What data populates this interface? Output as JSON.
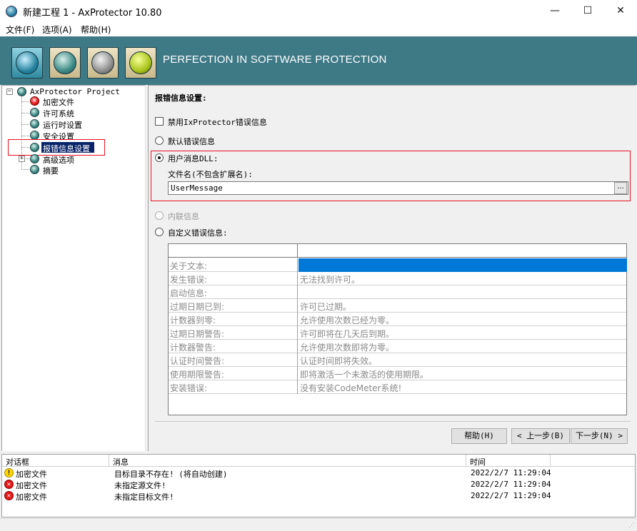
{
  "window": {
    "title": "新建工程 1 - AxProtector 10.80",
    "controls": {
      "minimize": "—",
      "maximize": "☐",
      "close": "✕"
    }
  },
  "menu": [
    "文件(F)",
    "选项(A)",
    "帮助(H)"
  ],
  "banner": {
    "tagline": "PERFECTION IN SOFTWARE PROTECTION",
    "tools": [
      "refresh-icon",
      "document-icon",
      "gears-icon",
      "settings-gear-icon"
    ]
  },
  "tree": {
    "root": "AxProtector Project",
    "items": [
      {
        "label": "加密文件",
        "icon": "error-icon",
        "expander": ""
      },
      {
        "label": "许可系统",
        "icon": "globe-icon",
        "expander": ""
      },
      {
        "label": "运行时设置",
        "icon": "globe-icon",
        "expander": ""
      },
      {
        "label": "安全设置",
        "icon": "globe-icon",
        "expander": ""
      },
      {
        "label": "报错信息设置",
        "icon": "globe-icon",
        "expander": "",
        "selected": true
      },
      {
        "label": "高级选项",
        "icon": "globe-icon",
        "expander": "+"
      },
      {
        "label": "摘要",
        "icon": "globe-icon",
        "expander": ""
      }
    ]
  },
  "panel": {
    "heading": "报错信息设置:",
    "disable_checkbox": "禁用IxProtector错误信息",
    "opt_default": "默认错误信息",
    "opt_user_dll": "用户消息DLL:",
    "filename_label": "文件名(不包含扩展名):",
    "filename_value": "UserMessage",
    "browse": "...",
    "opt_inline": "内联信息",
    "opt_custom": "自定义错误信息:",
    "grid": [
      {
        "key": "关于文本:",
        "value": ""
      },
      {
        "key": "发生错误:",
        "value": "无法找到许可。"
      },
      {
        "key": "启动信息:",
        "value": ""
      },
      {
        "key": "过期日期已到:",
        "value": "许可已过期。"
      },
      {
        "key": "计数器到零:",
        "value": "允许使用次数已经为零。"
      },
      {
        "key": "过期日期警告:",
        "value": "许可即将在几天后到期。"
      },
      {
        "key": "计数器警告:",
        "value": "允许使用次数即将为零。"
      },
      {
        "key": "认证时间警告:",
        "value": "认证时间即将失效。"
      },
      {
        "key": "使用期限警告:",
        "value": "即将激活一个未激活的使用期限。"
      },
      {
        "key": "安装错误:",
        "value": "没有安装CodeMeter系统!"
      }
    ],
    "buttons": {
      "help": "帮助(H)",
      "prev": "< 上一步(B)",
      "next": "下一步(N) >"
    }
  },
  "log": {
    "headers": {
      "dialog": "对话框",
      "message": "消息",
      "time": "时间"
    },
    "rows": [
      {
        "level": "warning",
        "level_glyph": "!",
        "dialog": "加密文件",
        "message": "目标目录不存在! (将自动创建)",
        "time": "2022/2/7  11:29:04"
      },
      {
        "level": "error",
        "level_glyph": "✕",
        "dialog": "加密文件",
        "message": "未指定源文件!",
        "time": "2022/2/7  11:29:04"
      },
      {
        "level": "error",
        "level_glyph": "✕",
        "dialog": "加密文件",
        "message": "未指定目标文件!",
        "time": "2022/2/7  11:29:04"
      }
    ]
  },
  "colors": {
    "banner": "#3e7a86",
    "selection": "#0078d7",
    "highlight_box": "#e81123"
  }
}
